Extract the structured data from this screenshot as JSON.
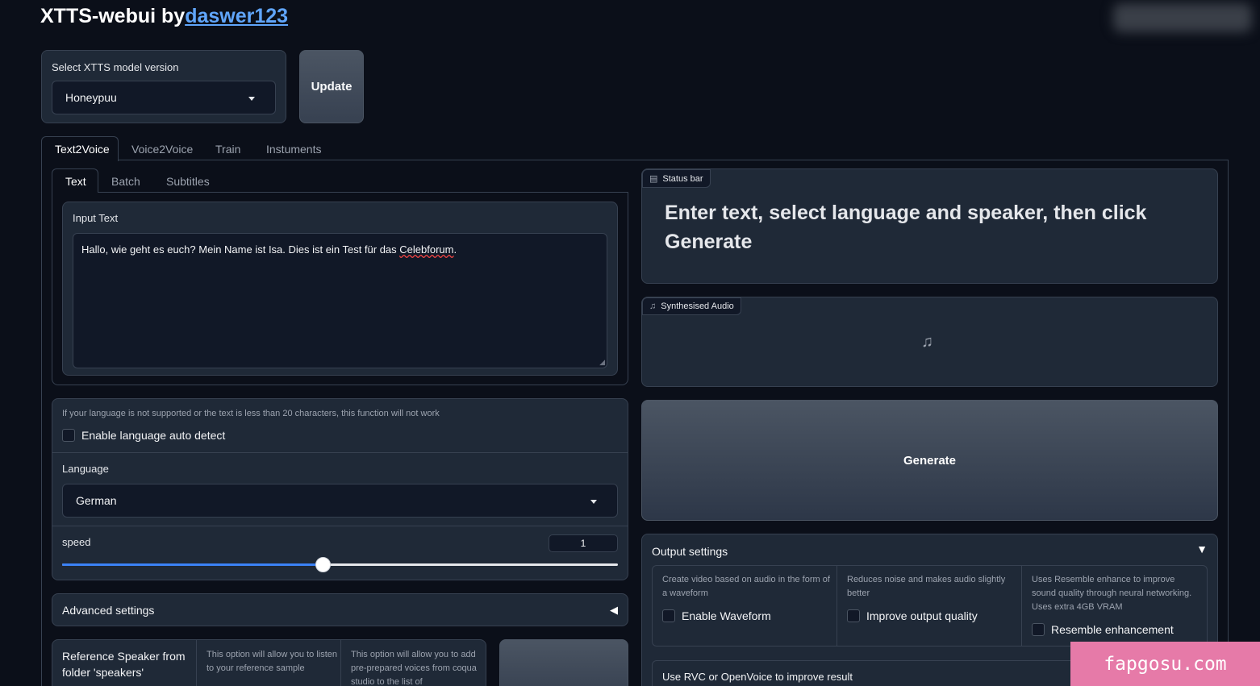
{
  "header": {
    "title_prefix": "XTTS-webui by",
    "author": "daswer123"
  },
  "model": {
    "label": "Select XTTS model version",
    "value": "Honeypuu",
    "update_label": "Update"
  },
  "main_tabs": [
    "Text2Voice",
    "Voice2Voice",
    "Train",
    "Instuments"
  ],
  "sub_tabs": [
    "Text",
    "Batch",
    "Subtitles"
  ],
  "input_text": {
    "label": "Input Text",
    "value_before": "Hallo, wie geht es euch? Mein Name ist Isa. Dies ist ein Test für das ",
    "value_misspelled": "Celebforum",
    "value_after": "."
  },
  "language": {
    "info": "If your language is not supported or the text is less than 20 characters, this function will not work",
    "auto_detect_label": "Enable language auto detect",
    "auto_detect_checked": false,
    "label": "Language",
    "value": "German"
  },
  "speed": {
    "label": "speed",
    "value": "1",
    "slider_fraction": 0.47
  },
  "advanced": {
    "label": "Advanced settings"
  },
  "reference": {
    "label": "Reference Speaker from folder 'speakers'",
    "info1": "This option will allow you to listen to your reference sample",
    "info2": "This option will allow you to add pre-prepared voices from coqua studio to the list of"
  },
  "status": {
    "label": "Status bar",
    "message": "Enter text, select language and speaker, then click Generate"
  },
  "audio": {
    "label": "Synthesised Audio"
  },
  "generate_label": "Generate",
  "output": {
    "label": "Output settings",
    "options": [
      {
        "info": "Create video based on audio in the form of a waveform",
        "label": "Enable Waveform"
      },
      {
        "info": "Reduces noise and makes audio slightly better",
        "label": "Improve output quality"
      },
      {
        "info": "Uses Resemble enhance to improve sound quality through neural networking. Uses extra 4GB VRAM",
        "label": "Resemble enhancement"
      }
    ],
    "rvc_label": "Use RVC or OpenVoice to improve result"
  },
  "watermark": "fapgosu.com",
  "colors": {
    "background": "#0b0f19",
    "panel": "#1f2937",
    "accent": "#3b82f6",
    "link": "#60a5fa"
  }
}
